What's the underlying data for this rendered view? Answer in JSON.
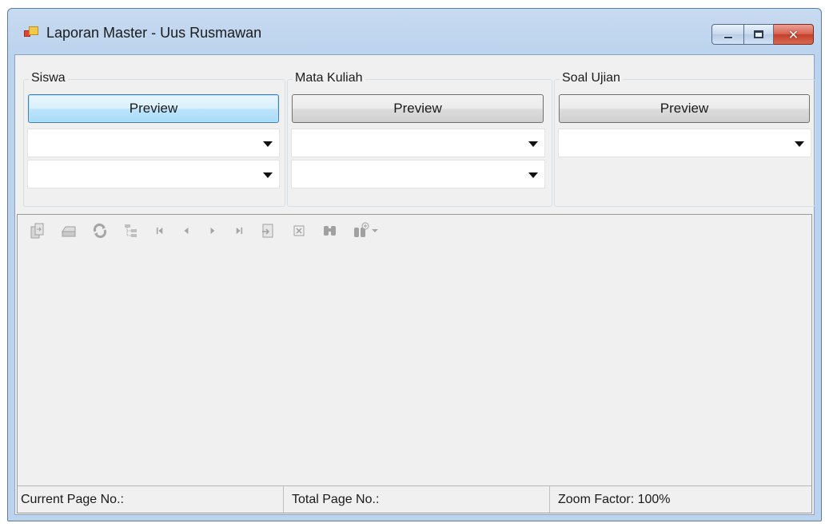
{
  "window": {
    "title": "Laporan Master - Uus Rusmawan"
  },
  "caption_buttons": {
    "minimize": "minimize",
    "maximize": "maximize",
    "close": "✕"
  },
  "groups": [
    {
      "label": "Siswa",
      "button": "Preview",
      "combos": [
        "",
        ""
      ]
    },
    {
      "label": "Mata Kuliah",
      "button": "Preview",
      "combos": [
        "",
        ""
      ]
    },
    {
      "label": "Soal Ujian",
      "button": "Preview",
      "combos": [
        ""
      ]
    }
  ],
  "toolbar": {
    "icons": [
      "export-icon",
      "print-icon",
      "refresh-icon",
      "group-tree-icon",
      "first-page-icon",
      "previous-page-icon",
      "next-page-icon",
      "last-page-icon",
      "goto-page-icon",
      "close-view-icon",
      "find-icon",
      "zoom-icon"
    ]
  },
  "status": {
    "current_page": "Current Page No.:",
    "total_page": "Total Page No.:",
    "zoom_factor": "Zoom Factor: 100%"
  }
}
